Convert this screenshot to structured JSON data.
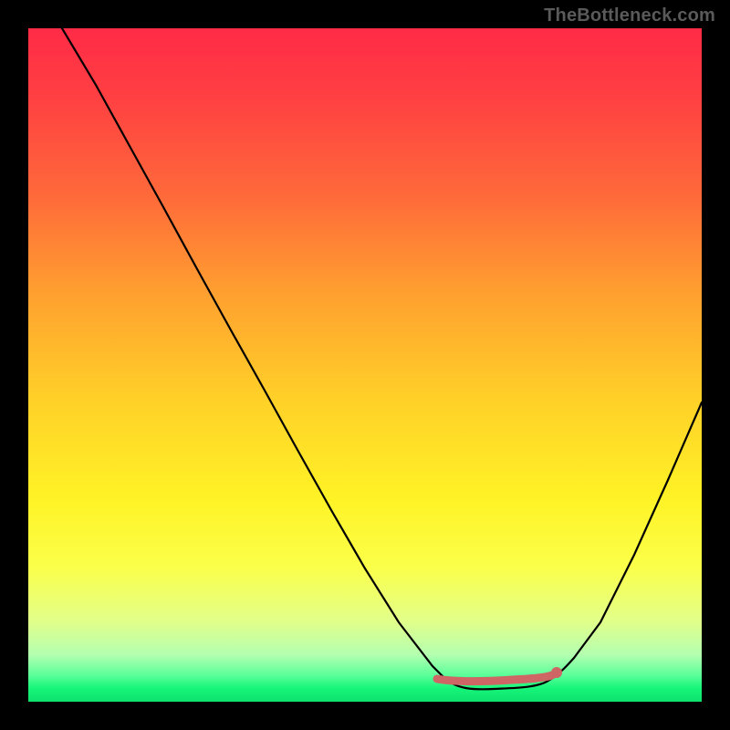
{
  "attribution": "TheBottleneck.com",
  "chart_data": {
    "type": "line",
    "title": "",
    "xlabel": "",
    "ylabel": "",
    "xlim": [
      0,
      100
    ],
    "ylim": [
      0,
      100
    ],
    "legend": false,
    "grid": false,
    "background": {
      "type": "gradient",
      "direction": "vertical",
      "stops": [
        {
          "pos": 0,
          "color": "#ff2b47"
        },
        {
          "pos": 25,
          "color": "#ff6a3a"
        },
        {
          "pos": 55,
          "color": "#ffd028"
        },
        {
          "pos": 80,
          "color": "#fbff4a"
        },
        {
          "pos": 100,
          "color": "#0de06e"
        }
      ]
    },
    "series": [
      {
        "name": "curve",
        "color": "#000000",
        "x": [
          5,
          10,
          15,
          20,
          25,
          30,
          35,
          40,
          45,
          50,
          55,
          60,
          62,
          65,
          70,
          75,
          78,
          80,
          85,
          90,
          95,
          100
        ],
        "y": [
          100,
          91,
          82,
          73,
          64,
          55,
          46,
          37,
          28,
          20,
          12,
          5,
          3,
          2,
          2,
          2,
          3,
          5,
          12,
          22,
          33,
          45
        ]
      },
      {
        "name": "highlight",
        "color": "#d36a6a",
        "x": [
          60,
          62,
          64,
          66,
          68,
          70,
          72,
          74,
          76,
          78
        ],
        "y": [
          3.5,
          3.5,
          3.5,
          3.5,
          3.5,
          3.5,
          3.5,
          3.5,
          3.5,
          3.5
        ]
      }
    ],
    "markers": [
      {
        "series": "highlight",
        "x": 78,
        "y": 4,
        "color": "#d36a6a",
        "size": 6
      }
    ]
  }
}
